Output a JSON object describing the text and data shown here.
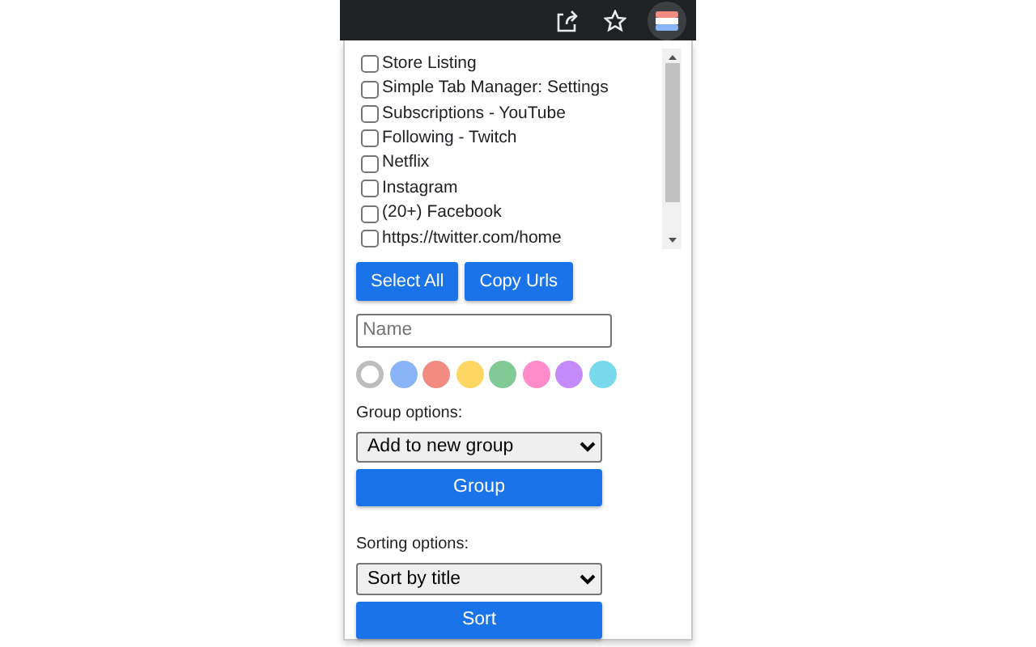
{
  "toolbar": {
    "buttons": [
      {
        "kind": "share"
      },
      {
        "kind": "star"
      },
      {
        "kind": "extension"
      }
    ]
  },
  "tabs": [
    {
      "title": "Store Listing",
      "checked": false
    },
    {
      "title": "Simple Tab Manager: Settings",
      "checked": false
    },
    {
      "title": "Subscriptions - YouTube",
      "checked": false
    },
    {
      "title": "Following - Twitch",
      "checked": false
    },
    {
      "title": "Netflix",
      "checked": false
    },
    {
      "title": "Instagram",
      "checked": false
    },
    {
      "title": "(20+) Facebook",
      "checked": false
    },
    {
      "title": "https://twitter.com/home",
      "checked": false
    }
  ],
  "actions": [
    "Select All",
    "Copy Urls"
  ],
  "name_field": {
    "placeholder": "Name"
  },
  "colors": [
    {
      "color": "#ffffff",
      "selected": true
    },
    {
      "color": "#8ab4f8",
      "selected": false
    },
    {
      "color": "#f28b82",
      "selected": false
    },
    {
      "color": "#fdd663",
      "selected": false
    },
    {
      "color": "#81c995",
      "selected": false
    },
    {
      "color": "#ff8bcb",
      "selected": false
    },
    {
      "color": "#c58af9",
      "selected": false
    },
    {
      "color": "#78d9ec",
      "selected": false
    }
  ],
  "group": {
    "label": "Group options:",
    "value": "Add to new group",
    "button": "Group"
  },
  "sorting": {
    "label": "Sorting options:",
    "value": "Sort by title",
    "button": "Sort"
  }
}
